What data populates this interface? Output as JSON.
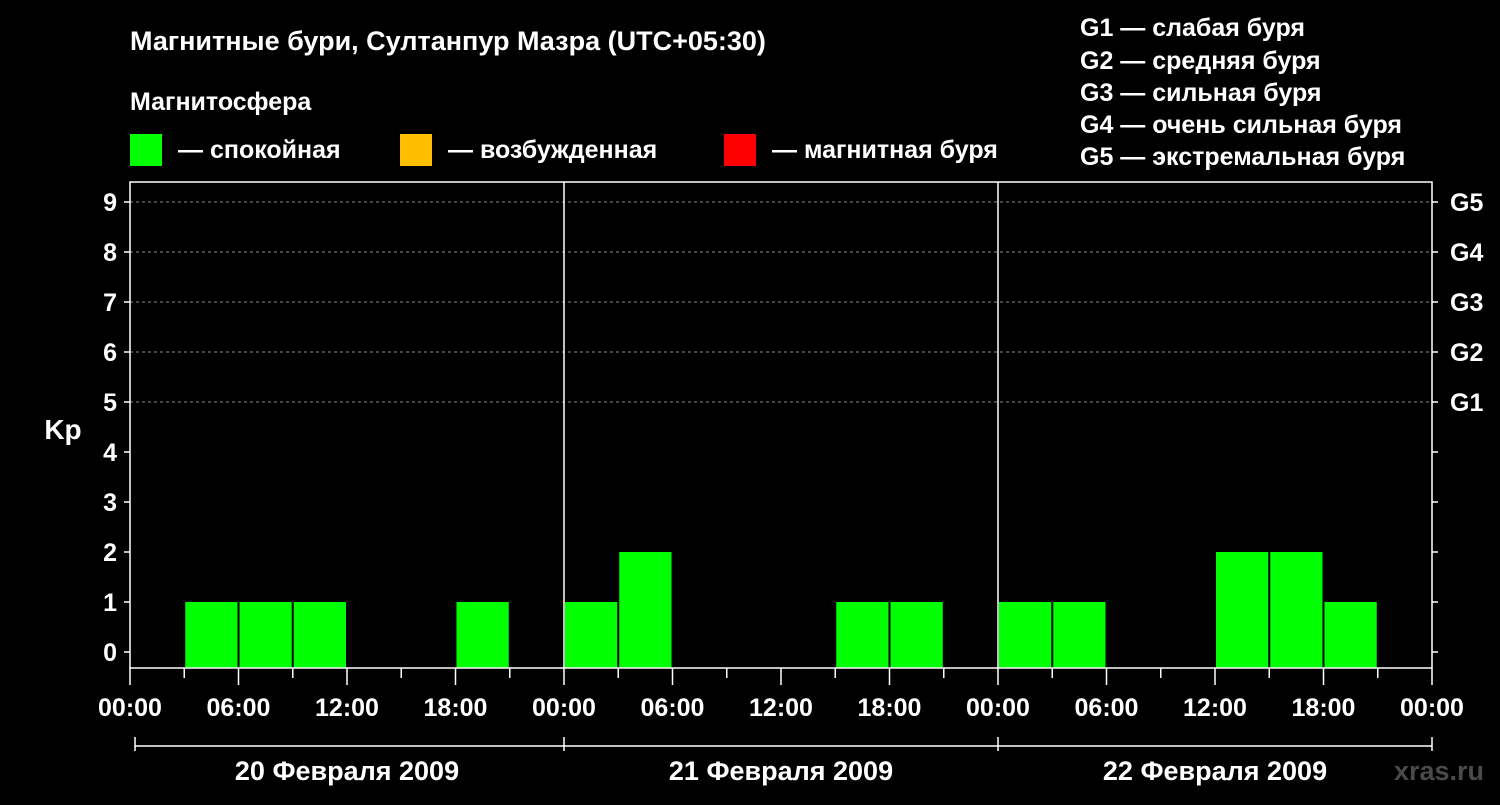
{
  "chart_data": {
    "type": "bar",
    "title": "Магнитные бури, Султанпур Мазра (UTC+05:30)",
    "subtitle": "Магнитосфера",
    "ylabel": "Kp",
    "ylim": [
      0,
      9
    ],
    "yticks": [
      "0",
      "1",
      "2",
      "3",
      "4",
      "5",
      "6",
      "7",
      "8",
      "9"
    ],
    "g_levels": [
      {
        "label": "G1",
        "kp": 5
      },
      {
        "label": "G2",
        "kp": 6
      },
      {
        "label": "G3",
        "kp": 7
      },
      {
        "label": "G4",
        "kp": 8
      },
      {
        "label": "G5",
        "kp": 9
      }
    ],
    "g_legend": [
      "G1 — слабая буря",
      "G2 — средняя буря",
      "G3 — сильная буря",
      "G4 — очень сильная буря",
      "G5 — экстремальная буря"
    ],
    "legend": [
      {
        "label": "— спокойная",
        "color": "#00ff00"
      },
      {
        "label": "— возбужденная",
        "color": "#ffbf00"
      },
      {
        "label": "— магнитная буря",
        "color": "#ff0000"
      }
    ],
    "xtick_labels": [
      "00:00",
      "06:00",
      "12:00",
      "18:00",
      "00:00",
      "06:00",
      "12:00",
      "18:00",
      "00:00",
      "06:00",
      "12:00",
      "18:00",
      "00:00"
    ],
    "hours_total": 72,
    "days": [
      "20 Февраля 2009",
      "21 Февраля 2009",
      "22 Февраля 2009"
    ],
    "bar_color": "#00ff00",
    "bars": [
      {
        "start_hour": 3,
        "kp": 1
      },
      {
        "start_hour": 6,
        "kp": 1
      },
      {
        "start_hour": 9,
        "kp": 1
      },
      {
        "start_hour": 18,
        "kp": 1
      },
      {
        "start_hour": 24,
        "kp": 1
      },
      {
        "start_hour": 27,
        "kp": 2
      },
      {
        "start_hour": 39,
        "kp": 1
      },
      {
        "start_hour": 42,
        "kp": 1
      },
      {
        "start_hour": 48,
        "kp": 1
      },
      {
        "start_hour": 51,
        "kp": 1
      },
      {
        "start_hour": 60,
        "kp": 2
      },
      {
        "start_hour": 63,
        "kp": 2
      },
      {
        "start_hour": 66,
        "kp": 1
      }
    ],
    "grid": "dashed horizontal at Kp 5–9",
    "watermark": "xras.ru"
  }
}
